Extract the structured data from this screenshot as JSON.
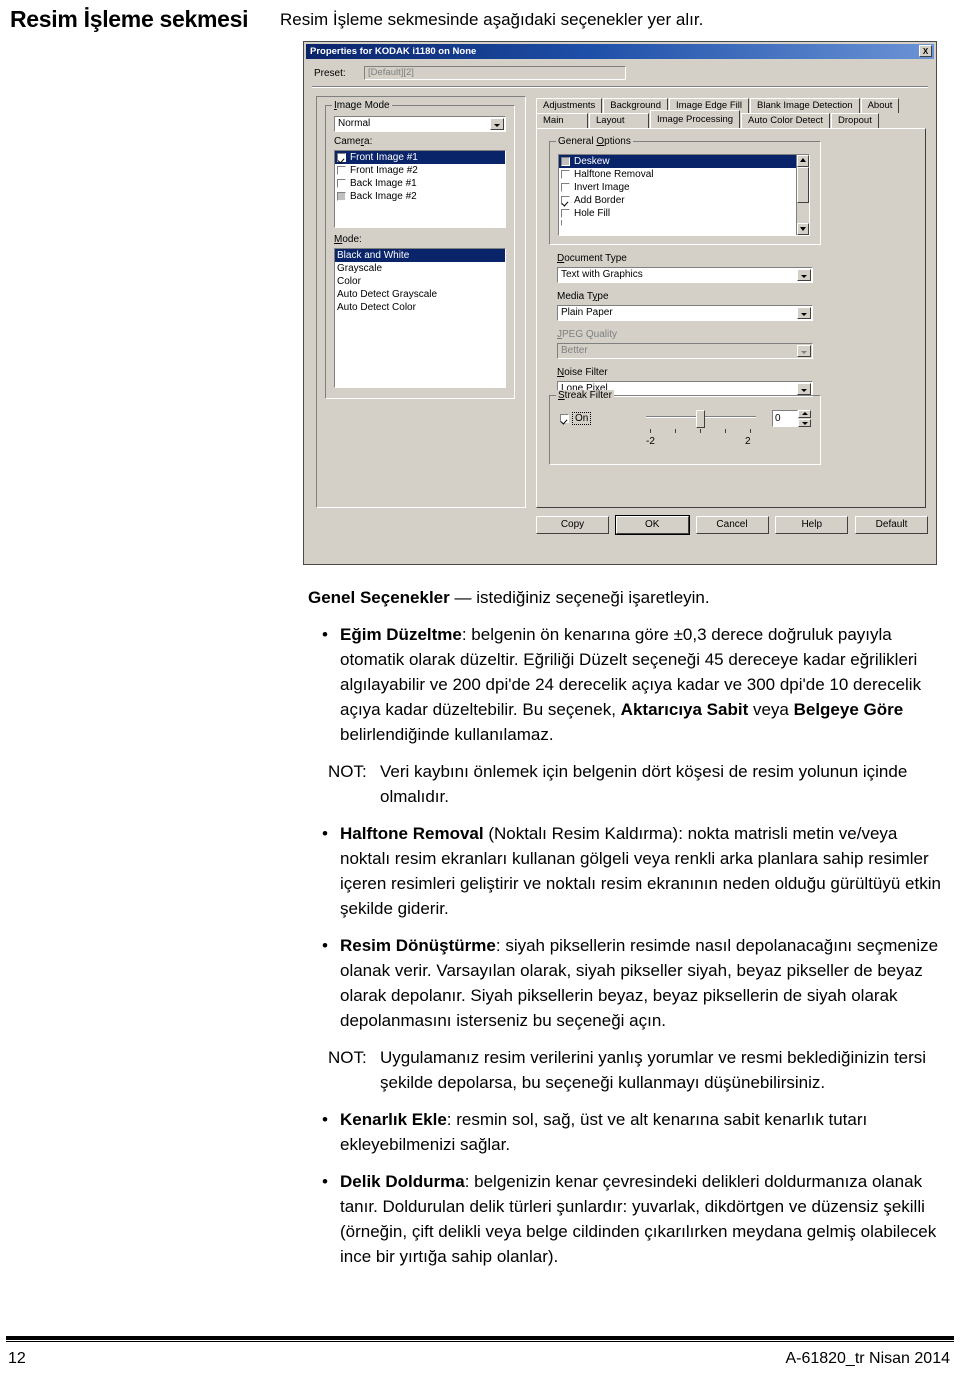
{
  "page": {
    "chapter_title": "Resim İşleme sekmesi",
    "intro": "Resim İşleme sekmesinde aşağıdaki seçenekler yer alır.",
    "footer_page_number": "12",
    "footer_doc_id": "A-61820_tr  Nisan 2014"
  },
  "dialog": {
    "title": "Properties for KODAK i1180 on None",
    "close_label": "X",
    "preset": {
      "label": "Preset:",
      "value": "[Default][2]"
    },
    "left_panel": {
      "image_mode_group": "Image Mode",
      "image_mode_value": "Normal",
      "camera_label": "Camera:",
      "camera_items": [
        {
          "label": "Front Image #1",
          "checked": true,
          "selected": true,
          "disabled": false
        },
        {
          "label": "Front Image #2",
          "checked": false,
          "selected": false,
          "disabled": false
        },
        {
          "label": "Back Image #1",
          "checked": false,
          "selected": false,
          "disabled": false
        },
        {
          "label": "Back Image #2",
          "checked": false,
          "selected": false,
          "disabled": true
        }
      ],
      "mode_label": "Mode:",
      "mode_items": [
        {
          "label": "Black and White",
          "selected": true
        },
        {
          "label": "Grayscale",
          "selected": false
        },
        {
          "label": "Color",
          "selected": false
        },
        {
          "label": "Auto Detect Grayscale",
          "selected": false
        },
        {
          "label": "Auto Detect Color",
          "selected": false
        }
      ]
    },
    "tabs_top": [
      {
        "label": "Adjustments",
        "active": false
      },
      {
        "label": "Background",
        "active": false
      },
      {
        "label": "Image Edge Fill",
        "active": false
      },
      {
        "label": "Blank Image Detection",
        "active": false
      },
      {
        "label": "About",
        "active": false
      }
    ],
    "tabs_bottom": [
      {
        "label": "Main",
        "active": false
      },
      {
        "label": "Layout",
        "active": false
      },
      {
        "label": "Image Processing",
        "active": true
      },
      {
        "label": "Auto Color Detect",
        "active": false
      },
      {
        "label": "Dropout",
        "active": false
      }
    ],
    "general_options": {
      "group_label": "General Options",
      "items": [
        {
          "label": "Deskew",
          "checked": false,
          "selected": true,
          "disabled": true
        },
        {
          "label": "Halftone Removal",
          "checked": false,
          "selected": false,
          "disabled": false
        },
        {
          "label": "Invert Image",
          "checked": false,
          "selected": false,
          "disabled": false
        },
        {
          "label": "Add Border",
          "checked": true,
          "selected": false,
          "disabled": false
        },
        {
          "label": "Hole Fill",
          "checked": false,
          "selected": false,
          "disabled": false
        }
      ]
    },
    "document_type": {
      "label": "Document Type",
      "value": "Text with Graphics",
      "disabled": false
    },
    "media_type": {
      "label": "Media Type",
      "value": "Plain Paper",
      "disabled": false
    },
    "jpeg_quality": {
      "label": "JPEG Quality",
      "value": "Better",
      "disabled": true
    },
    "noise_filter": {
      "label": "Noise Filter",
      "value": "Lone Pixel",
      "disabled": false
    },
    "streak_filter": {
      "group_label": "Streak Filter",
      "on_label": "On",
      "on_checked": true,
      "slider_value": "0",
      "slider_min": "-2",
      "slider_max": "2"
    },
    "buttons": {
      "copy": "Copy",
      "ok": "OK",
      "cancel": "Cancel",
      "help": "Help",
      "default": "Default"
    }
  },
  "content": {
    "heading_bold": "Genel Seçenekler",
    "heading_rest": " — istediğiniz seçeneği işaretleyin.",
    "bullets": [
      {
        "bold": "Eğim Düzeltme",
        "text": ": belgenin ön kenarına göre ±0,3 derece doğruluk payıyla otomatik olarak düzeltir. Eğriliği Düzelt seçeneği 45 dereceye kadar eğrilikleri algılayabilir ve 200 dpi'de 24 derecelik açıya kadar ve 300 dpi'de 10 derecelik açıya kadar düzeltebilir. Bu seçenek, ",
        "bold2": "Aktarıcıya Sabit",
        "text2": " veya ",
        "bold3": "Belgeye Göre",
        "text3": " belirlendiğinde kullanılamaz."
      },
      {
        "bold": "Halftone Removal",
        "text": " (Noktalı Resim Kaldırma): nokta matrisli metin ve/veya noktalı resim ekranları kullanan gölgeli veya renkli arka planlara sahip resimler içeren resimleri geliştirir ve noktalı resim ekranının neden olduğu gürültüyü etkin şekilde giderir."
      },
      {
        "bold": "Resim Dönüştürme",
        "text": ": siyah piksellerin resimde nasıl depolanacağını seçmenize olanak verir. Varsayılan olarak, siyah pikseller siyah, beyaz pikseller de beyaz olarak depolanır. Siyah piksellerin beyaz, beyaz piksellerin de siyah olarak depolanmasını isterseniz bu seçeneği açın."
      },
      {
        "bold": "Kenarlık Ekle",
        "text": ": resmin sol, sağ, üst ve alt kenarına sabit kenarlık tutarı ekleyebilmenizi sağlar."
      },
      {
        "bold": "Delik Doldurma",
        "text": ": belgenizin kenar çevresindeki delikleri doldurmanıza olanak tanır. Doldurulan delik türleri şunlardır: yuvarlak, dikdörtgen ve düzensiz şekilli (örneğin, çift delikli veya belge cildinden çıkarılırken meydana gelmiş olabilecek ince bir yırtığa sahip olanlar)."
      }
    ],
    "notes": [
      {
        "label": "NOT:",
        "text": "Veri kaybını önlemek için belgenin dört köşesi de resim yolunun içinde olmalıdır."
      },
      {
        "label": "NOT:",
        "text": "Uygulamanız resim verilerini yanlış yorumlar ve resmi beklediğinizin tersi şekilde depolarsa, bu seçeneği kullanmayı düşünebilirsiniz."
      }
    ]
  },
  "colors": {
    "dialog_face": "#d4d0c8",
    "titlebar_start": "#0a246a",
    "titlebar_end": "#6b93d6",
    "selection": "#0a246a"
  }
}
